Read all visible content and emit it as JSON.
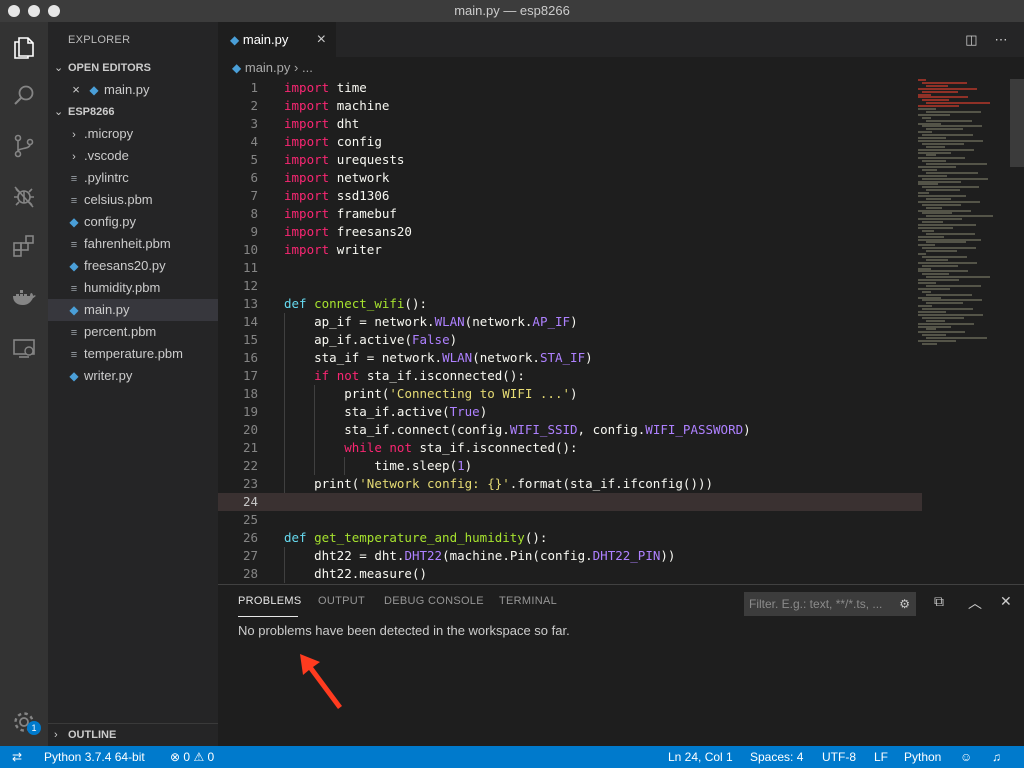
{
  "window": {
    "title": "main.py — esp8266"
  },
  "activity_bar": {
    "icons": [
      "files-icon",
      "search-icon",
      "source-control-icon",
      "debug-icon",
      "extensions-icon",
      "docker-icon",
      "remote-explorer-icon",
      "settings-gear-icon"
    ],
    "settings_badge": "1"
  },
  "sidebar": {
    "title": "EXPLORER",
    "open_editors": {
      "label": "OPEN EDITORS",
      "items": [
        {
          "name": "main.py"
        }
      ]
    },
    "project": {
      "label": "ESP8266",
      "items": [
        {
          "name": ".micropy",
          "kind": "folder"
        },
        {
          "name": ".vscode",
          "kind": "folder"
        },
        {
          "name": ".pylintrc",
          "kind": "file"
        },
        {
          "name": "celsius.pbm",
          "kind": "file"
        },
        {
          "name": "config.py",
          "kind": "python"
        },
        {
          "name": "fahrenheit.pbm",
          "kind": "file"
        },
        {
          "name": "freesans20.py",
          "kind": "python"
        },
        {
          "name": "humidity.pbm",
          "kind": "file"
        },
        {
          "name": "main.py",
          "kind": "python"
        },
        {
          "name": "percent.pbm",
          "kind": "file"
        },
        {
          "name": "temperature.pbm",
          "kind": "file"
        },
        {
          "name": "writer.py",
          "kind": "python"
        }
      ]
    },
    "outline": {
      "label": "OUTLINE"
    }
  },
  "editor": {
    "tab": {
      "label": "main.py"
    },
    "breadcrumb": {
      "file": "main.py",
      "rest": "..."
    },
    "lines": [
      {
        "n": "1",
        "text": "import time"
      },
      {
        "n": "2",
        "text": "import machine"
      },
      {
        "n": "3",
        "text": "import dht"
      },
      {
        "n": "4",
        "text": "import config"
      },
      {
        "n": "5",
        "text": "import urequests"
      },
      {
        "n": "6",
        "text": "import network"
      },
      {
        "n": "7",
        "text": "import ssd1306"
      },
      {
        "n": "8",
        "text": "import framebuf"
      },
      {
        "n": "9",
        "text": "import freesans20"
      },
      {
        "n": "10",
        "text": "import writer"
      },
      {
        "n": "11",
        "text": ""
      },
      {
        "n": "12",
        "text": ""
      },
      {
        "n": "13",
        "text": "def connect_wifi():"
      },
      {
        "n": "14",
        "text": "    ap_if = network.WLAN(network.AP_IF)"
      },
      {
        "n": "15",
        "text": "    ap_if.active(False)"
      },
      {
        "n": "16",
        "text": "    sta_if = network.WLAN(network.STA_IF)"
      },
      {
        "n": "17",
        "text": "    if not sta_if.isconnected():"
      },
      {
        "n": "18",
        "text": "        print('Connecting to WIFI ...')"
      },
      {
        "n": "19",
        "text": "        sta_if.active(True)"
      },
      {
        "n": "20",
        "text": "        sta_if.connect(config.WIFI_SSID, config.WIFI_PASSWORD)"
      },
      {
        "n": "21",
        "text": "        while not sta_if.isconnected():"
      },
      {
        "n": "22",
        "text": "            time.sleep(1)"
      },
      {
        "n": "23",
        "text": "    print('Network config: {}'.format(sta_if.ifconfig()))"
      },
      {
        "n": "24",
        "text": ""
      },
      {
        "n": "25",
        "text": ""
      },
      {
        "n": "26",
        "text": "def get_temperature_and_humidity():"
      },
      {
        "n": "27",
        "text": "    dht22 = dht.DHT22(machine.Pin(config.DHT22_PIN))"
      },
      {
        "n": "28",
        "text": "    dht22.measure()"
      }
    ],
    "current_line": "24"
  },
  "panel": {
    "tabs": [
      "PROBLEMS",
      "OUTPUT",
      "DEBUG CONSOLE",
      "TERMINAL"
    ],
    "active_tab": "PROBLEMS",
    "filter_placeholder": "Filter. E.g.: text, **/*.ts, ...",
    "message": "No problems have been detected in the workspace so far."
  },
  "status_bar": {
    "interpreter": "Python 3.7.4 64-bit",
    "errors": "0",
    "warnings": "0",
    "position": "Ln 24, Col 1",
    "spaces": "Spaces: 4",
    "encoding": "UTF-8",
    "eol": "LF",
    "language": "Python"
  },
  "colors": {
    "accent": "#007acc",
    "keyword": "#f92672",
    "function": "#a6e22e",
    "string": "#e6db74",
    "constant": "#ae81ff",
    "annotation_arrow": "#ff3b1f"
  }
}
